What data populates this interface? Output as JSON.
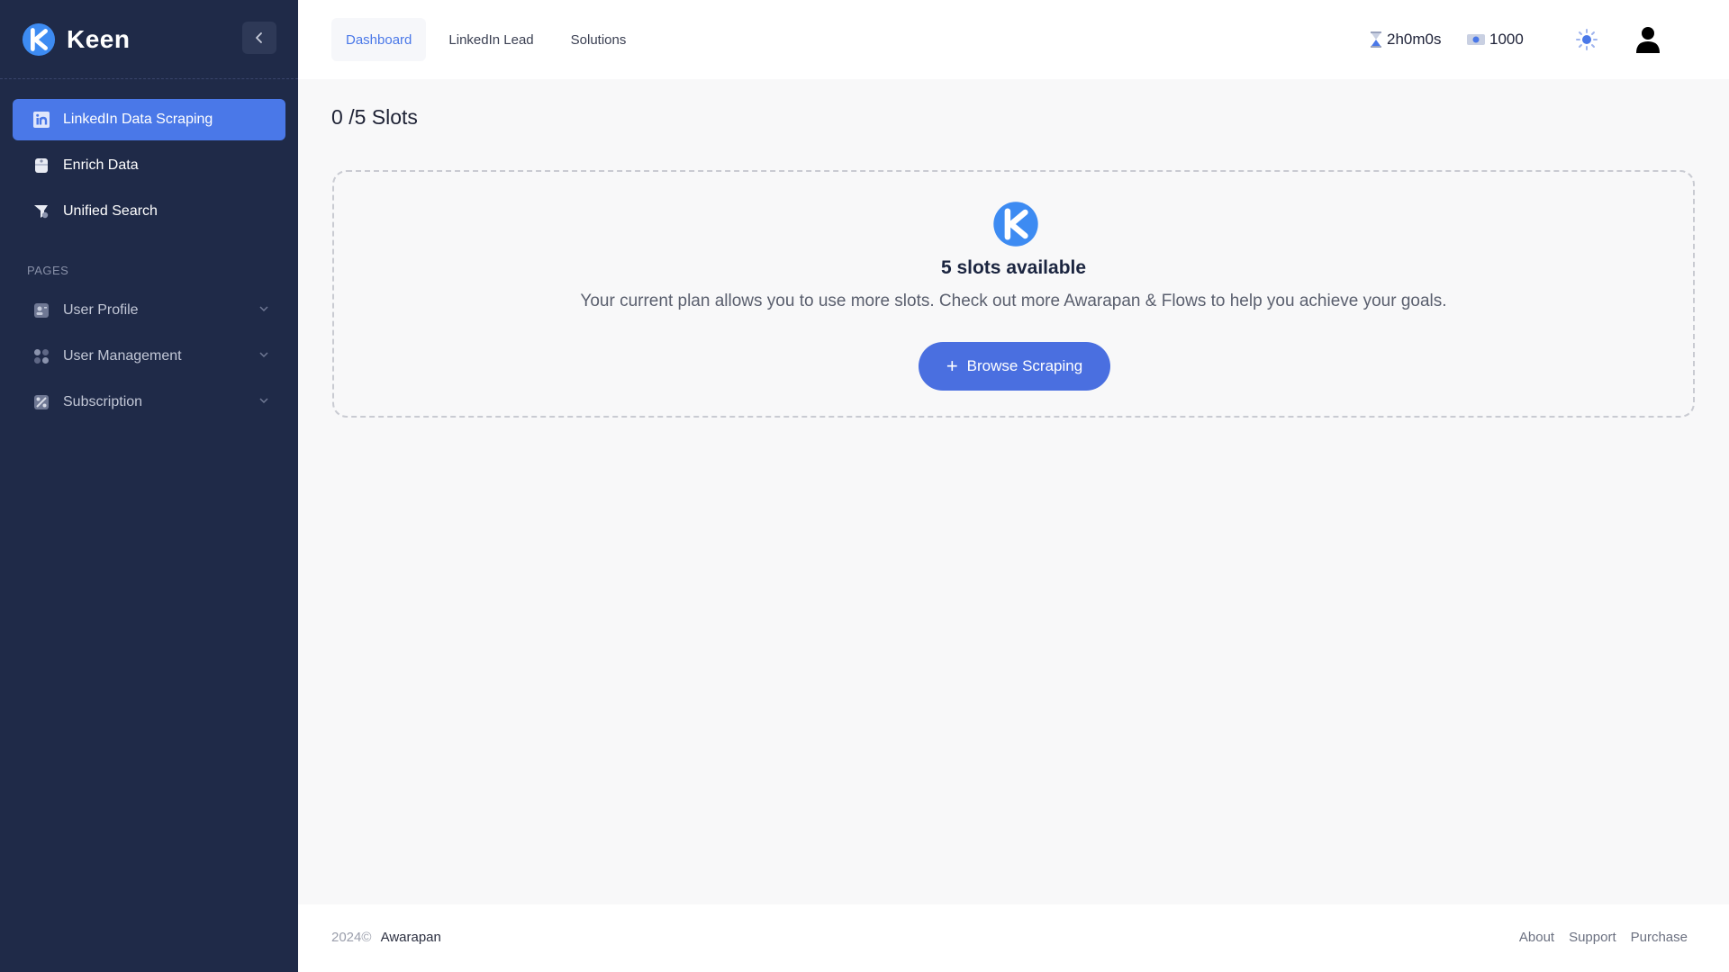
{
  "app": {
    "name": "Keen"
  },
  "sidebar": {
    "collapse_icon": "chevron-left-icon",
    "menu": [
      {
        "label": "LinkedIn Data Scraping",
        "icon": "linkedin-icon",
        "active": true
      },
      {
        "label": "Enrich Data",
        "icon": "database-icon",
        "active": false
      },
      {
        "label": "Unified Search",
        "icon": "search-icon",
        "active": false
      }
    ],
    "section_label": "PAGES",
    "pages": [
      {
        "label": "User Profile",
        "icon": "profile-icon"
      },
      {
        "label": "User Management",
        "icon": "users-icon"
      },
      {
        "label": "Subscription",
        "icon": "subscription-icon"
      }
    ]
  },
  "header": {
    "tabs": [
      {
        "label": "Dashboard",
        "active": true
      },
      {
        "label": "LinkedIn Lead",
        "active": false
      },
      {
        "label": "Solutions",
        "active": false
      }
    ],
    "timer": "2h0m0s",
    "credits": "1000",
    "theme_icon": "sun-icon",
    "user_icon": "user-icon"
  },
  "main": {
    "slots_used": "0",
    "slots_total": "/5 Slots",
    "box": {
      "heading": "5 slots available",
      "text": "Your current plan allows you to use more slots. Check out more Awarapan & Flows to help you achieve your goals.",
      "button": "Browse Scraping"
    }
  },
  "footer": {
    "year": "2024©",
    "brand": "Awarapan",
    "links": [
      "About",
      "Support",
      "Purchase"
    ]
  },
  "colors": {
    "sidebar_bg": "#1f2a48",
    "accent": "#4a78e8",
    "button": "#4a6fe0"
  }
}
